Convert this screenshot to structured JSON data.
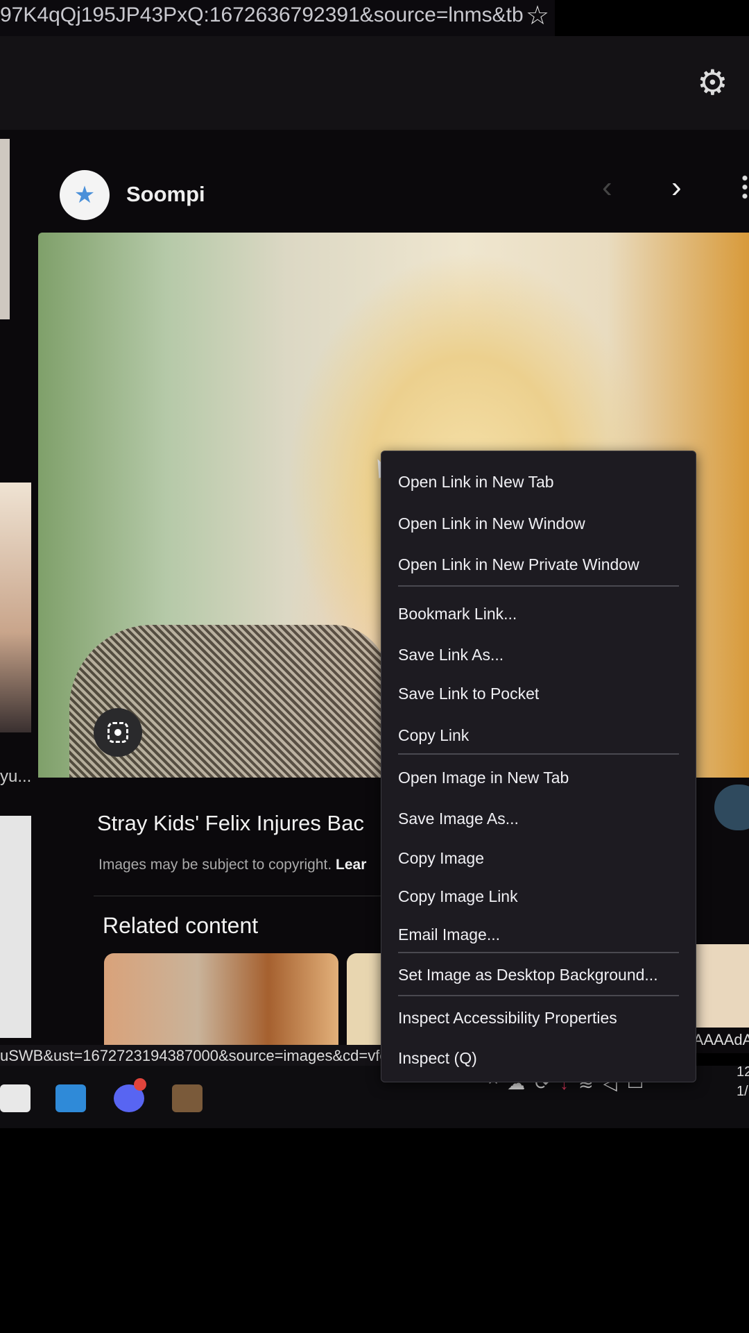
{
  "browser": {
    "url_fragment": "97K4qQj195JP43PxQ:1672636792391&source=lnms&tb",
    "bookmark_icon": "star-outline-icon",
    "settings_icon": "gear-icon"
  },
  "panel": {
    "source_name": "Soompi",
    "source_icon": "star-icon",
    "prev_icon": "chevron-left-icon",
    "next_icon": "chevron-right-icon",
    "more_icon": "kebab-icon",
    "lens_icon": "lens-icon",
    "left_caption": "yu...",
    "title": "Stray Kids' Felix Injures Bac",
    "copyright": "Images may be subject to copyright.",
    "learn_more": "Lear",
    "related_heading": "Related content"
  },
  "status_bar": {
    "url_left": "uSWB&ust=1672723194387000&source=images&cd=vfe",
    "url_right": "AAAAAdA"
  },
  "context_menu": {
    "items": [
      {
        "label": "Open Link in New Tab"
      },
      {
        "label": "Open Link in New Window"
      },
      {
        "label": "Open Link in New Private Window"
      },
      {
        "label": "Bookmark Link..."
      },
      {
        "label": "Save Link As..."
      },
      {
        "label": "Save Link to Pocket"
      },
      {
        "label": "Copy Link"
      },
      {
        "label": "Open Image in New Tab"
      },
      {
        "label": "Save Image As..."
      },
      {
        "label": "Copy Image"
      },
      {
        "label": "Copy Image Link"
      },
      {
        "label": "Email Image..."
      },
      {
        "label": "Set Image as Desktop Background..."
      },
      {
        "label": "Inspect Accessibility Properties"
      },
      {
        "label": "Inspect (Q)"
      }
    ]
  },
  "taskbar": {
    "apps": [
      "store-icon",
      "mail-icon",
      "discord-icon",
      "minecraft-icon"
    ],
    "tray": [
      "chevron-up-icon",
      "onedrive-icon",
      "sync-icon",
      "microphone-icon",
      "wifi-icon",
      "volume-icon",
      "battery-icon"
    ],
    "clock_partial": "12",
    "date_partial": "1/"
  },
  "colors": {
    "menu_bg": "#1d1b21",
    "page_bg": "#0b090c",
    "accent_blue": "#4a90d9",
    "discord": "#5865f2",
    "badge_red": "#e0443c"
  }
}
